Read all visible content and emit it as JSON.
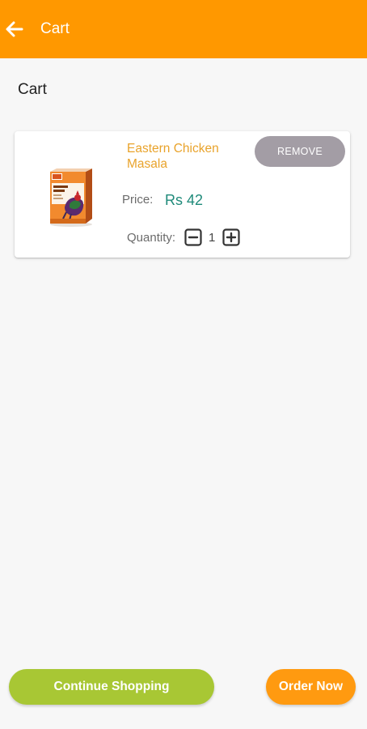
{
  "colors": {
    "appbar": "#ff9800",
    "background": "#f7f7f7",
    "product_name": "#e9a32b",
    "price": "#1f8a7a",
    "remove_button": "#a39da5",
    "continue_button": "#a8c734",
    "order_button": "#ff9a10"
  },
  "appbar": {
    "back_icon": "arrow-left-icon",
    "title": "Cart"
  },
  "page": {
    "title": "Cart"
  },
  "cart": {
    "items": [
      {
        "image": "masala-box-product-image",
        "name": "Eastern Chicken Masala",
        "remove_label": "REMOVE",
        "price_label": "Price:",
        "price": "Rs 42",
        "quantity_label": "Quantity:",
        "quantity": "1",
        "decrement_icon": "minus-square-icon",
        "increment_icon": "plus-square-icon"
      }
    ]
  },
  "footer": {
    "continue_label": "Continue Shopping",
    "order_label": "Order Now"
  }
}
